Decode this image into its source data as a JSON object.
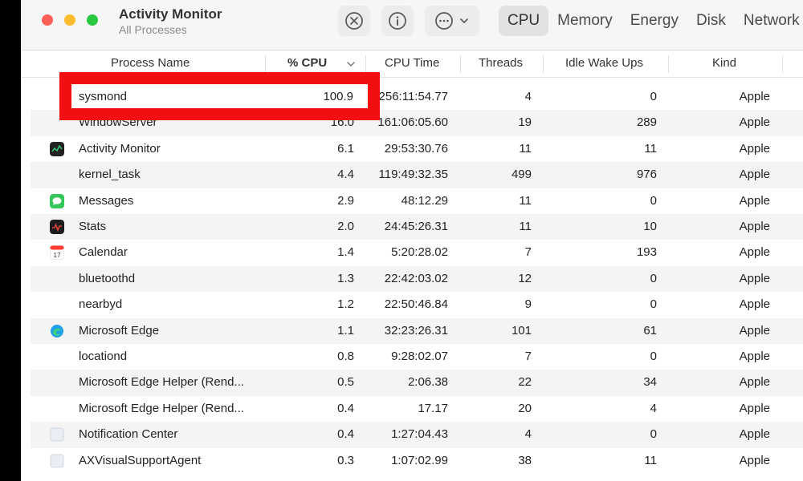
{
  "window": {
    "title": "Activity Monitor",
    "subtitle": "All Processes"
  },
  "toolbar": {
    "stop_icon": "xmark-circle-icon",
    "info_icon": "info-circle-icon",
    "more_icon": "ellipsis-circle-icon",
    "tabs": [
      "CPU",
      "Memory",
      "Energy",
      "Disk",
      "Network"
    ],
    "active_tab": "CPU"
  },
  "columns": {
    "name": "Process Name",
    "cpu": "% CPU",
    "cpu_time": "CPU Time",
    "threads": "Threads",
    "idle": "Idle Wake Ups",
    "kind": "Kind"
  },
  "processes": [
    {
      "name": "sysmond",
      "cpu": "100.9",
      "time": "256:11:54.77",
      "threads": "4",
      "idle": "0",
      "kind": "Apple",
      "icon": "none"
    },
    {
      "name": "WindowServer",
      "cpu": "16.0",
      "time": "161:06:05.60",
      "threads": "19",
      "idle": "289",
      "kind": "Apple",
      "icon": "none"
    },
    {
      "name": "Activity Monitor",
      "cpu": "6.1",
      "time": "29:53:30.76",
      "threads": "11",
      "idle": "11",
      "kind": "Apple",
      "icon": "activity-monitor-icon"
    },
    {
      "name": "kernel_task",
      "cpu": "4.4",
      "time": "119:49:32.35",
      "threads": "499",
      "idle": "976",
      "kind": "Apple",
      "icon": "none"
    },
    {
      "name": "Messages",
      "cpu": "2.9",
      "time": "48:12.29",
      "threads": "11",
      "idle": "0",
      "kind": "Apple",
      "icon": "messages-icon"
    },
    {
      "name": "Stats",
      "cpu": "2.0",
      "time": "24:45:26.31",
      "threads": "11",
      "idle": "10",
      "kind": "Apple",
      "icon": "stats-icon"
    },
    {
      "name": "Calendar",
      "cpu": "1.4",
      "time": "5:20:28.02",
      "threads": "7",
      "idle": "193",
      "kind": "Apple",
      "icon": "calendar-icon"
    },
    {
      "name": "bluetoothd",
      "cpu": "1.3",
      "time": "22:42:03.02",
      "threads": "12",
      "idle": "0",
      "kind": "Apple",
      "icon": "none"
    },
    {
      "name": "nearbyd",
      "cpu": "1.2",
      "time": "22:50:46.84",
      "threads": "9",
      "idle": "0",
      "kind": "Apple",
      "icon": "none"
    },
    {
      "name": "Microsoft Edge",
      "cpu": "1.1",
      "time": "32:23:26.31",
      "threads": "101",
      "idle": "61",
      "kind": "Apple",
      "icon": "edge-icon"
    },
    {
      "name": "locationd",
      "cpu": "0.8",
      "time": "9:28:02.07",
      "threads": "7",
      "idle": "0",
      "kind": "Apple",
      "icon": "none"
    },
    {
      "name": "Microsoft Edge Helper (Rend...",
      "cpu": "0.5",
      "time": "2:06.38",
      "threads": "22",
      "idle": "34",
      "kind": "Apple",
      "icon": "none"
    },
    {
      "name": "Microsoft Edge Helper (Rend...",
      "cpu": "0.4",
      "time": "17.17",
      "threads": "20",
      "idle": "4",
      "kind": "Apple",
      "icon": "none"
    },
    {
      "name": "Notification Center",
      "cpu": "0.4",
      "time": "1:27:04.43",
      "threads": "4",
      "idle": "0",
      "kind": "Apple",
      "icon": "notification-center-icon"
    },
    {
      "name": "AXVisualSupportAgent",
      "cpu": "0.3",
      "time": "1:07:02.99",
      "threads": "38",
      "idle": "11",
      "kind": "Apple",
      "icon": "ax-agent-icon"
    }
  ],
  "colors": {
    "highlight": "#f20f10",
    "row_alt": "#f4f4f4"
  }
}
